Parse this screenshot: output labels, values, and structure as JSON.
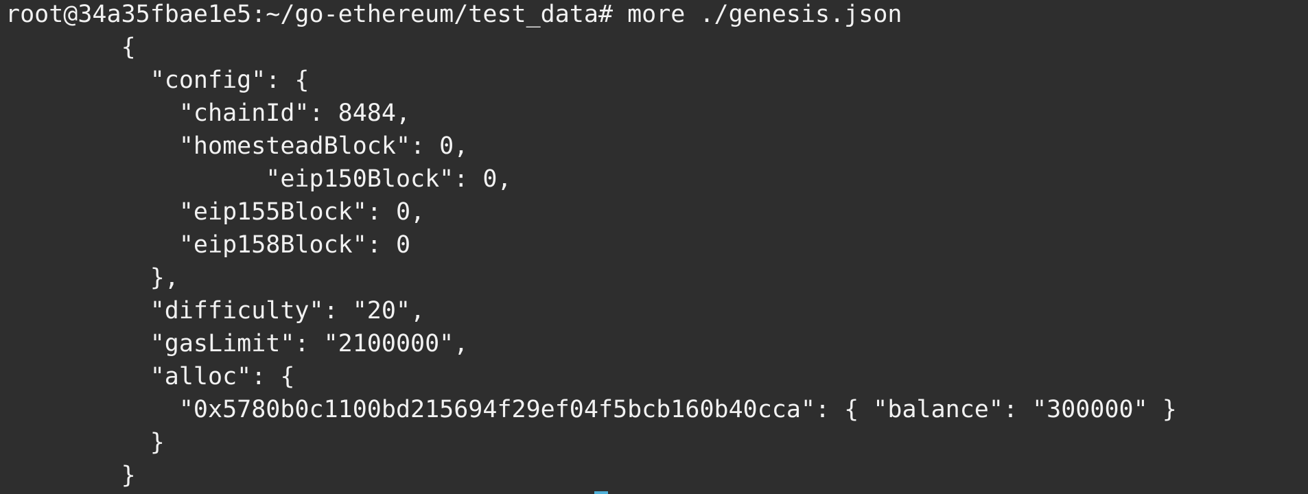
{
  "terminal": {
    "background_color": "#2e2e2e",
    "text_color": "#f2f2f2",
    "cursor_color": "#4fb0d8",
    "prompt": "root@34a35fbae1e5:~/go-ethereum/test_data# ",
    "command": "more ./genesis.json",
    "lines": [
      "        {",
      "          \"config\": {",
      "            \"chainId\": 8484,",
      "            \"homesteadBlock\": 0,",
      "                  \"eip150Block\": 0,",
      "            \"eip155Block\": 0,",
      "            \"eip158Block\": 0",
      "          },",
      "          \"difficulty\": \"20\",",
      "          \"gasLimit\": \"2100000\",",
      "          \"alloc\": {",
      "            \"0x5780b0c1100bd215694f29ef04f5bcb160b40cca\": { \"balance\": \"300000\" }",
      "          }",
      "        }"
    ]
  }
}
